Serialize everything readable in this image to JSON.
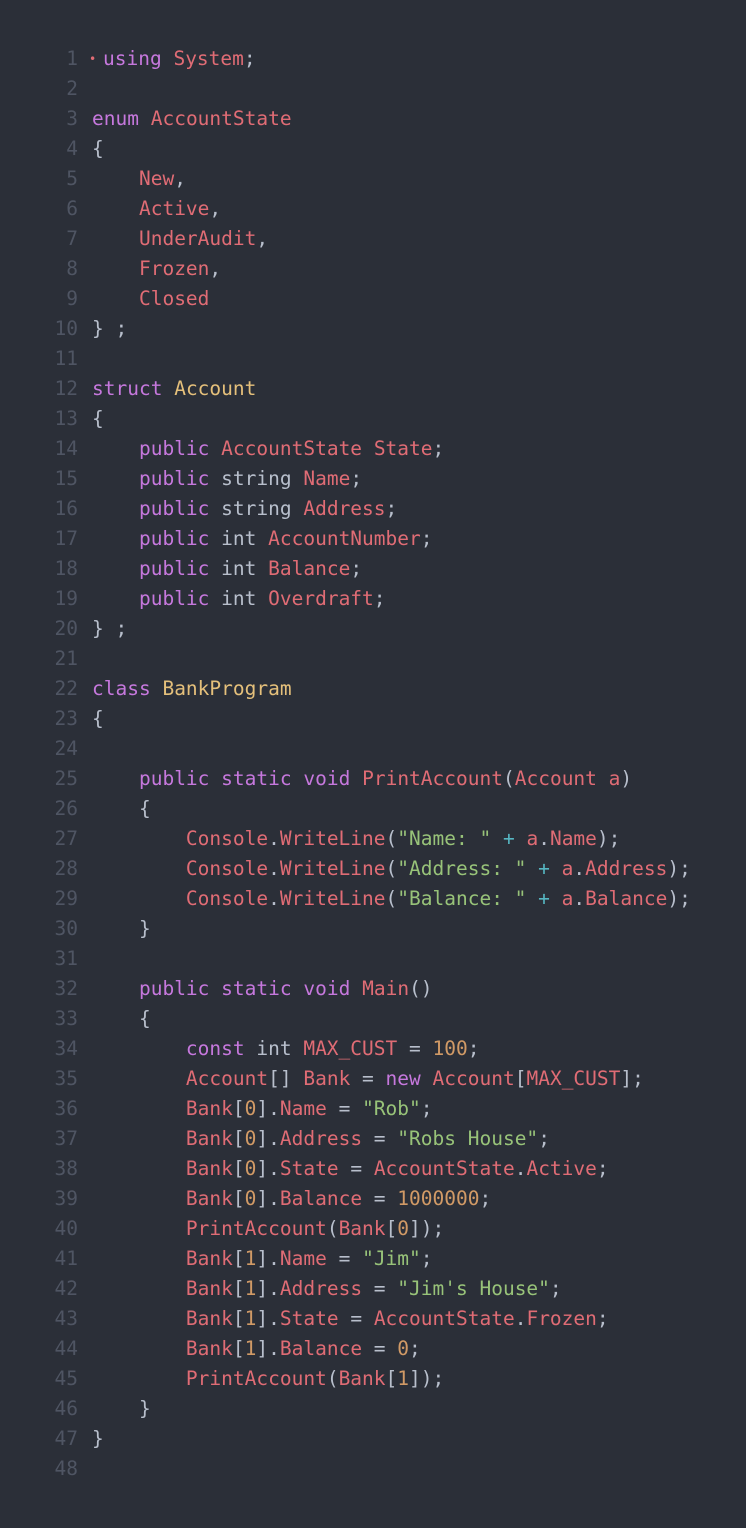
{
  "editor": {
    "colors": {
      "background": "#2b2f38",
      "line_number": "#4f5563",
      "keyword": "#c678dd",
      "type": "#e5c07b",
      "identifier": "#e06c75",
      "string": "#98c379",
      "number": "#d19a66",
      "operator": "#56b6c2",
      "plain": "#b8bfcc"
    },
    "breakpoint_marker": "•",
    "lines": [
      {
        "n": "1",
        "t": [
          [
            "kw",
            "using"
          ],
          [
            "pl",
            " "
          ],
          [
            "id",
            "System"
          ],
          [
            "pl",
            ";"
          ]
        ]
      },
      {
        "n": "2",
        "t": []
      },
      {
        "n": "3",
        "t": [
          [
            "kw",
            "enum"
          ],
          [
            "pl",
            " "
          ],
          [
            "id",
            "AccountState"
          ]
        ]
      },
      {
        "n": "4",
        "t": [
          [
            "pl",
            "{"
          ]
        ]
      },
      {
        "n": "5",
        "t": [
          [
            "pl",
            "    "
          ],
          [
            "id",
            "New"
          ],
          [
            "pl",
            ","
          ]
        ]
      },
      {
        "n": "6",
        "t": [
          [
            "pl",
            "    "
          ],
          [
            "id",
            "Active"
          ],
          [
            "pl",
            ","
          ]
        ]
      },
      {
        "n": "7",
        "t": [
          [
            "pl",
            "    "
          ],
          [
            "id",
            "UnderAudit"
          ],
          [
            "pl",
            ","
          ]
        ]
      },
      {
        "n": "8",
        "t": [
          [
            "pl",
            "    "
          ],
          [
            "id",
            "Frozen"
          ],
          [
            "pl",
            ","
          ]
        ]
      },
      {
        "n": "9",
        "t": [
          [
            "pl",
            "    "
          ],
          [
            "id",
            "Closed"
          ]
        ]
      },
      {
        "n": "10",
        "t": [
          [
            "pl",
            "} ;"
          ]
        ]
      },
      {
        "n": "11",
        "t": []
      },
      {
        "n": "12",
        "t": [
          [
            "kw",
            "struct"
          ],
          [
            "pl",
            " "
          ],
          [
            "ty",
            "Account"
          ]
        ]
      },
      {
        "n": "13",
        "t": [
          [
            "pl",
            "{"
          ]
        ]
      },
      {
        "n": "14",
        "t": [
          [
            "pl",
            "    "
          ],
          [
            "kw",
            "public"
          ],
          [
            "pl",
            " "
          ],
          [
            "id",
            "AccountState"
          ],
          [
            "pl",
            " "
          ],
          [
            "id",
            "State"
          ],
          [
            "pl",
            ";"
          ]
        ]
      },
      {
        "n": "15",
        "t": [
          [
            "pl",
            "    "
          ],
          [
            "kw",
            "public"
          ],
          [
            "pl",
            " string "
          ],
          [
            "id",
            "Name"
          ],
          [
            "pl",
            ";"
          ]
        ]
      },
      {
        "n": "16",
        "t": [
          [
            "pl",
            "    "
          ],
          [
            "kw",
            "public"
          ],
          [
            "pl",
            " string "
          ],
          [
            "id",
            "Address"
          ],
          [
            "pl",
            ";"
          ]
        ]
      },
      {
        "n": "17",
        "t": [
          [
            "pl",
            "    "
          ],
          [
            "kw",
            "public"
          ],
          [
            "pl",
            " int "
          ],
          [
            "id",
            "AccountNumber"
          ],
          [
            "pl",
            ";"
          ]
        ]
      },
      {
        "n": "18",
        "t": [
          [
            "pl",
            "    "
          ],
          [
            "kw",
            "public"
          ],
          [
            "pl",
            " int "
          ],
          [
            "id",
            "Balance"
          ],
          [
            "pl",
            ";"
          ]
        ]
      },
      {
        "n": "19",
        "t": [
          [
            "pl",
            "    "
          ],
          [
            "kw",
            "public"
          ],
          [
            "pl",
            " int "
          ],
          [
            "id",
            "Overdraft"
          ],
          [
            "pl",
            ";"
          ]
        ]
      },
      {
        "n": "20",
        "t": [
          [
            "pl",
            "} ;"
          ]
        ]
      },
      {
        "n": "21",
        "t": []
      },
      {
        "n": "22",
        "t": [
          [
            "kw",
            "class"
          ],
          [
            "pl",
            " "
          ],
          [
            "ty",
            "BankProgram"
          ]
        ]
      },
      {
        "n": "23",
        "t": [
          [
            "pl",
            "{"
          ]
        ]
      },
      {
        "n": "24",
        "t": []
      },
      {
        "n": "25",
        "t": [
          [
            "pl",
            "    "
          ],
          [
            "kw",
            "public"
          ],
          [
            "pl",
            " "
          ],
          [
            "kw",
            "static"
          ],
          [
            "pl",
            " "
          ],
          [
            "kw",
            "void"
          ],
          [
            "pl",
            " "
          ],
          [
            "id",
            "PrintAccount"
          ],
          [
            "pl",
            "("
          ],
          [
            "id",
            "Account"
          ],
          [
            "pl",
            " "
          ],
          [
            "id",
            "a"
          ],
          [
            "pl",
            ")"
          ]
        ]
      },
      {
        "n": "26",
        "t": [
          [
            "pl",
            "    {"
          ]
        ]
      },
      {
        "n": "27",
        "t": [
          [
            "pl",
            "        "
          ],
          [
            "id",
            "Console"
          ],
          [
            "pl",
            "."
          ],
          [
            "id",
            "WriteLine"
          ],
          [
            "pl",
            "("
          ],
          [
            "str",
            "\"Name: \""
          ],
          [
            "pl",
            " "
          ],
          [
            "op",
            "+"
          ],
          [
            "pl",
            " "
          ],
          [
            "id",
            "a"
          ],
          [
            "pl",
            "."
          ],
          [
            "id",
            "Name"
          ],
          [
            "pl",
            ");"
          ]
        ]
      },
      {
        "n": "28",
        "t": [
          [
            "pl",
            "        "
          ],
          [
            "id",
            "Console"
          ],
          [
            "pl",
            "."
          ],
          [
            "id",
            "WriteLine"
          ],
          [
            "pl",
            "("
          ],
          [
            "str",
            "\"Address: \""
          ],
          [
            "pl",
            " "
          ],
          [
            "op",
            "+"
          ],
          [
            "pl",
            " "
          ],
          [
            "id",
            "a"
          ],
          [
            "pl",
            "."
          ],
          [
            "id",
            "Address"
          ],
          [
            "pl",
            ");"
          ]
        ]
      },
      {
        "n": "29",
        "t": [
          [
            "pl",
            "        "
          ],
          [
            "id",
            "Console"
          ],
          [
            "pl",
            "."
          ],
          [
            "id",
            "WriteLine"
          ],
          [
            "pl",
            "("
          ],
          [
            "str",
            "\"Balance: \""
          ],
          [
            "pl",
            " "
          ],
          [
            "op",
            "+"
          ],
          [
            "pl",
            " "
          ],
          [
            "id",
            "a"
          ],
          [
            "pl",
            "."
          ],
          [
            "id",
            "Balance"
          ],
          [
            "pl",
            ");"
          ]
        ]
      },
      {
        "n": "30",
        "t": [
          [
            "pl",
            "    }"
          ]
        ]
      },
      {
        "n": "31",
        "t": []
      },
      {
        "n": "32",
        "t": [
          [
            "pl",
            "    "
          ],
          [
            "kw",
            "public"
          ],
          [
            "pl",
            " "
          ],
          [
            "kw",
            "static"
          ],
          [
            "pl",
            " "
          ],
          [
            "kw",
            "void"
          ],
          [
            "pl",
            " "
          ],
          [
            "id",
            "Main"
          ],
          [
            "pl",
            "()"
          ]
        ]
      },
      {
        "n": "33",
        "t": [
          [
            "pl",
            "    {"
          ]
        ]
      },
      {
        "n": "34",
        "t": [
          [
            "pl",
            "        "
          ],
          [
            "kw",
            "const"
          ],
          [
            "pl",
            " int "
          ],
          [
            "id",
            "MAX_CUST"
          ],
          [
            "pl",
            " = "
          ],
          [
            "num",
            "100"
          ],
          [
            "pl",
            ";"
          ]
        ]
      },
      {
        "n": "35",
        "t": [
          [
            "pl",
            "        "
          ],
          [
            "id",
            "Account"
          ],
          [
            "pl",
            "[] "
          ],
          [
            "id",
            "Bank"
          ],
          [
            "pl",
            " = "
          ],
          [
            "kw",
            "new"
          ],
          [
            "pl",
            " "
          ],
          [
            "id",
            "Account"
          ],
          [
            "pl",
            "["
          ],
          [
            "id",
            "MAX_CUST"
          ],
          [
            "pl",
            "];"
          ]
        ]
      },
      {
        "n": "36",
        "t": [
          [
            "pl",
            "        "
          ],
          [
            "id",
            "Bank"
          ],
          [
            "pl",
            "["
          ],
          [
            "num",
            "0"
          ],
          [
            "pl",
            "]."
          ],
          [
            "id",
            "Name"
          ],
          [
            "pl",
            " = "
          ],
          [
            "str",
            "\"Rob\""
          ],
          [
            "pl",
            ";"
          ]
        ]
      },
      {
        "n": "37",
        "t": [
          [
            "pl",
            "        "
          ],
          [
            "id",
            "Bank"
          ],
          [
            "pl",
            "["
          ],
          [
            "num",
            "0"
          ],
          [
            "pl",
            "]."
          ],
          [
            "id",
            "Address"
          ],
          [
            "pl",
            " = "
          ],
          [
            "str",
            "\"Robs House\""
          ],
          [
            "pl",
            ";"
          ]
        ]
      },
      {
        "n": "38",
        "t": [
          [
            "pl",
            "        "
          ],
          [
            "id",
            "Bank"
          ],
          [
            "pl",
            "["
          ],
          [
            "num",
            "0"
          ],
          [
            "pl",
            "]."
          ],
          [
            "id",
            "State"
          ],
          [
            "pl",
            " = "
          ],
          [
            "id",
            "AccountState"
          ],
          [
            "pl",
            "."
          ],
          [
            "id",
            "Active"
          ],
          [
            "pl",
            ";"
          ]
        ]
      },
      {
        "n": "39",
        "t": [
          [
            "pl",
            "        "
          ],
          [
            "id",
            "Bank"
          ],
          [
            "pl",
            "["
          ],
          [
            "num",
            "0"
          ],
          [
            "pl",
            "]."
          ],
          [
            "id",
            "Balance"
          ],
          [
            "pl",
            " = "
          ],
          [
            "num",
            "1000000"
          ],
          [
            "pl",
            ";"
          ]
        ]
      },
      {
        "n": "40",
        "t": [
          [
            "pl",
            "        "
          ],
          [
            "id",
            "PrintAccount"
          ],
          [
            "pl",
            "("
          ],
          [
            "id",
            "Bank"
          ],
          [
            "pl",
            "["
          ],
          [
            "num",
            "0"
          ],
          [
            "pl",
            "]);"
          ]
        ]
      },
      {
        "n": "41",
        "t": [
          [
            "pl",
            "        "
          ],
          [
            "id",
            "Bank"
          ],
          [
            "pl",
            "["
          ],
          [
            "num",
            "1"
          ],
          [
            "pl",
            "]."
          ],
          [
            "id",
            "Name"
          ],
          [
            "pl",
            " = "
          ],
          [
            "str",
            "\"Jim\""
          ],
          [
            "pl",
            ";"
          ]
        ]
      },
      {
        "n": "42",
        "t": [
          [
            "pl",
            "        "
          ],
          [
            "id",
            "Bank"
          ],
          [
            "pl",
            "["
          ],
          [
            "num",
            "1"
          ],
          [
            "pl",
            "]."
          ],
          [
            "id",
            "Address"
          ],
          [
            "pl",
            " = "
          ],
          [
            "str",
            "\"Jim's House\""
          ],
          [
            "pl",
            ";"
          ]
        ]
      },
      {
        "n": "43",
        "t": [
          [
            "pl",
            "        "
          ],
          [
            "id",
            "Bank"
          ],
          [
            "pl",
            "["
          ],
          [
            "num",
            "1"
          ],
          [
            "pl",
            "]."
          ],
          [
            "id",
            "State"
          ],
          [
            "pl",
            " = "
          ],
          [
            "id",
            "AccountState"
          ],
          [
            "pl",
            "."
          ],
          [
            "id",
            "Frozen"
          ],
          [
            "pl",
            ";"
          ]
        ]
      },
      {
        "n": "44",
        "t": [
          [
            "pl",
            "        "
          ],
          [
            "id",
            "Bank"
          ],
          [
            "pl",
            "["
          ],
          [
            "num",
            "1"
          ],
          [
            "pl",
            "]."
          ],
          [
            "id",
            "Balance"
          ],
          [
            "pl",
            " = "
          ],
          [
            "num",
            "0"
          ],
          [
            "pl",
            ";"
          ]
        ]
      },
      {
        "n": "45",
        "t": [
          [
            "pl",
            "        "
          ],
          [
            "id",
            "PrintAccount"
          ],
          [
            "pl",
            "("
          ],
          [
            "id",
            "Bank"
          ],
          [
            "pl",
            "["
          ],
          [
            "num",
            "1"
          ],
          [
            "pl",
            "]);"
          ]
        ]
      },
      {
        "n": "46",
        "t": [
          [
            "pl",
            "    }"
          ]
        ]
      },
      {
        "n": "47",
        "t": [
          [
            "pl",
            "}"
          ]
        ]
      },
      {
        "n": "48",
        "t": []
      }
    ]
  }
}
